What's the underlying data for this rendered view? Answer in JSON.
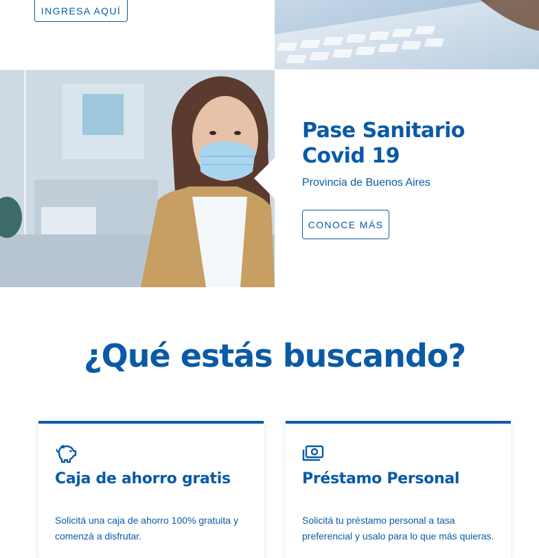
{
  "top_banner": {
    "button_label": "INGRESA AQUÍ"
  },
  "covid_banner": {
    "title": "Pase Sanitario Covid 19",
    "subtitle": "Provincia de Buenos Aires",
    "button_label": "CONOCE MÁS"
  },
  "section": {
    "title": "¿Qué estás buscando?"
  },
  "cards": [
    {
      "icon": "piggy-bank-icon",
      "title": "Caja de ahorro gratis",
      "description": "Solicitá una caja de ahorro 100% gratuita y comenzá a disfrutar."
    },
    {
      "icon": "money-icon",
      "title": "Préstamo Personal",
      "description": "Solicitá tu préstamo personal a tasa preferencial y usalo para lo que más quieras."
    }
  ],
  "colors": {
    "brand_blue": "#0a5aa6",
    "background": "#ffffff"
  }
}
